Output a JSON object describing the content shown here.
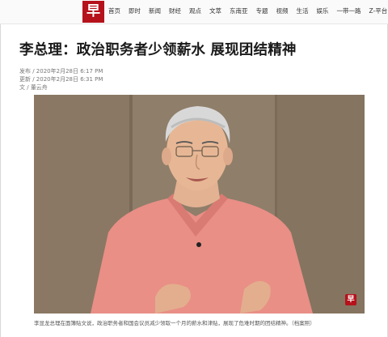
{
  "site": {
    "logo_char": "早",
    "nav": [
      "首页",
      "即时",
      "新闻",
      "财经",
      "观点",
      "文萃",
      "东南亚",
      "专题",
      "视频",
      "生活",
      "娱乐",
      "一带一路",
      "Z-平台"
    ]
  },
  "article": {
    "headline": "李总理：政治职务者少领薪水 展现团结精神",
    "published": "发布 / 2020年2月28日 6:17 PM",
    "updated": "更新 / 2020年2月28日 6:31 PM",
    "author_prefix": "文 / ",
    "author": "董云舟",
    "caption": "李显龙总理在面簿贴文说，政治职务者和国会议员减少领取一个月的薪水和津贴，展现了危难时期的团结精神。（档案照）",
    "photo_badge": "早"
  },
  "colors": {
    "brand": "#b5121b"
  }
}
